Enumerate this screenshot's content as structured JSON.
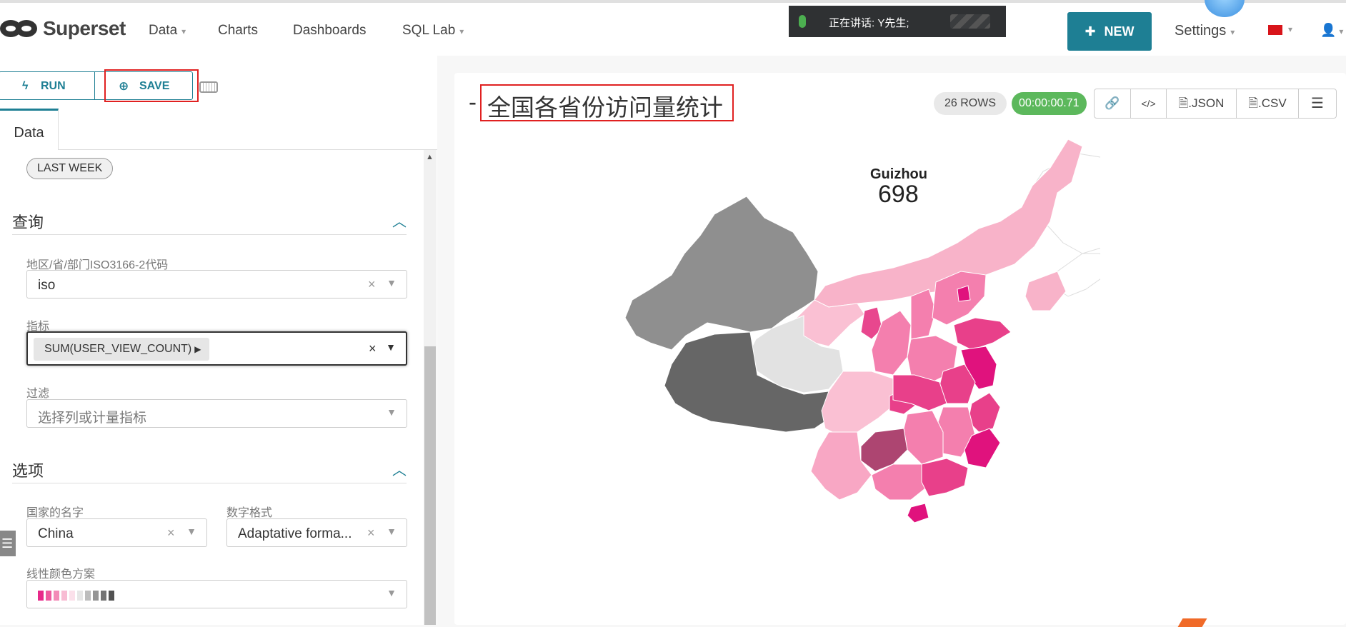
{
  "app": {
    "name": "Superset"
  },
  "nav": {
    "items": [
      {
        "label": "Data",
        "caret": true
      },
      {
        "label": "Charts",
        "caret": false
      },
      {
        "label": "Dashboards",
        "caret": false
      },
      {
        "label": "SQL Lab",
        "caret": true
      }
    ],
    "new_label": "NEW",
    "settings_label": "Settings"
  },
  "notification": {
    "text": "正在讲话: Y先生;"
  },
  "toolbar": {
    "run_label": "RUN",
    "save_label": "SAVE"
  },
  "left": {
    "tab_label": "Data",
    "time_range_value": "LAST WEEK",
    "query_section": {
      "title": "查询",
      "region_label": "地区/省/部门ISO3166-2代码",
      "region_value": "iso",
      "metric_label": "指标",
      "metric_value": "SUM(USER_VIEW_COUNT)",
      "filter_label": "过滤",
      "filter_placeholder": "选择列或计量指标"
    },
    "options_section": {
      "title": "选项",
      "country_label": "国家的名字",
      "country_value": "China",
      "number_format_label": "数字格式",
      "number_format_value": "Adaptative forma...",
      "color_scheme_label": "线性颜色方案",
      "color_scheme_colors": [
        "#e7298a",
        "#ee5a9f",
        "#f38bb7",
        "#f8bcd3",
        "#fbe0ea",
        "#e6e6e6",
        "#bdbdbd",
        "#969696",
        "#737373",
        "#525252"
      ]
    }
  },
  "chart": {
    "title": "全国各省份访问量统计",
    "title_prefix": "-",
    "rows_badge": "26 ROWS",
    "timer": "00:00:00.71",
    "actions": [
      ".JSON",
      ".CSV"
    ],
    "action_icons": [
      "link-icon",
      "code-icon",
      "json-file-icon",
      "csv-file-icon",
      "menu-icon"
    ],
    "hover_region": "Guizhou",
    "hover_value": "698",
    "highlight_color": "#ad4571"
  }
}
